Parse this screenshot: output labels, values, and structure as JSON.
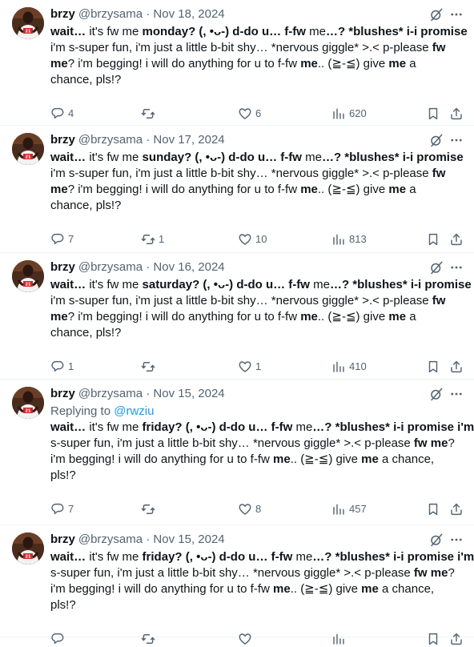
{
  "tweets": [
    {
      "name": "brzy",
      "meta": "@brzysama · Nov 18, 2024",
      "reply_prefix": "",
      "reply_handle": "",
      "lines": [
        [
          "|wait… |it's fw me| monday? (, •ᴗ-) d-do u… f-fw |me|…? *blushes* i-i promise"
        ],
        [
          "i'm s-super fun, i'm just a little b-bit shy… *nervous giggle* >.< p-please |fw"
        ],
        [
          "|me|? i'm begging! i will do anything for u to f-fw |me|.. (≧-≦) give |me| a"
        ],
        [
          "chance, pls!?"
        ]
      ],
      "replies": "4",
      "reposts": "",
      "likes": "6",
      "views": "620"
    },
    {
      "name": "brzy",
      "meta": "@brzysama · Nov 17, 2024",
      "reply_prefix": "",
      "reply_handle": "",
      "lines": [
        [
          "|wait… |it's fw me| sunday? (, •ᴗ-) d-do u… f-fw |me|…? *blushes* i-i promise"
        ],
        [
          "i'm s-super fun, i'm just a little b-bit shy… *nervous giggle* >.< p-please |fw"
        ],
        [
          "|me|? i'm begging! i will do anything for u to f-fw |me|.. (≧-≦) give |me| a"
        ],
        [
          "chance, pls!?"
        ]
      ],
      "replies": "7",
      "reposts": "1",
      "likes": "10",
      "views": "813"
    },
    {
      "name": "brzy",
      "meta": "@brzysama · Nov 16, 2024",
      "reply_prefix": "",
      "reply_handle": "",
      "lines": [
        [
          "|wait… |it's fw me| saturday? (, •ᴗ-) d-do u… f-fw |me|…? *blushes* i-i promise"
        ],
        [
          "i'm s-super fun, i'm just a little b-bit shy… *nervous giggle* >.< p-please |fw"
        ],
        [
          "|me|? i'm begging! i will do anything for u to f-fw |me|.. (≧-≦) give |me| a"
        ],
        [
          "chance, pls!?"
        ]
      ],
      "replies": "1",
      "reposts": "",
      "likes": "1",
      "views": "410"
    },
    {
      "name": "brzy",
      "meta": "@brzysama · Nov 15, 2024",
      "reply_prefix": "Replying to ",
      "reply_handle": "@rwziu",
      "lines": [
        [
          "|wait… |it's fw me| friday? (, •ᴗ-) d-do u… f-fw |me|…? *blushes* i-i promise i'm"
        ],
        [
          "s-super fun, i'm just a little b-bit shy… *nervous giggle* >.< p-please |fw me|?"
        ],
        [
          "i'm begging! i will do anything for u to f-fw |me|.. (≧-≦) give |me| a chance,"
        ],
        [
          "pls!?"
        ]
      ],
      "replies": "7",
      "reposts": "",
      "likes": "8",
      "views": "457"
    },
    {
      "name": "brzy",
      "meta": "@brzysama · Nov 15, 2024",
      "reply_prefix": "",
      "reply_handle": "",
      "lines": [
        [
          "|wait… |it's fw me| friday? (, •ᴗ-) d-do u… f-fw |me|…? *blushes* i-i promise i'm"
        ],
        [
          "s-super fun, i'm just a little b-bit shy… *nervous giggle* >.< p-please |fw me|?"
        ],
        [
          "i'm begging! i will do anything for u to f-fw |me|.. (≧-≦) give |me| a chance,"
        ],
        [
          "pls!?"
        ]
      ],
      "replies": "",
      "reposts": "",
      "likes": "",
      "views": ""
    }
  ],
  "icons": {
    "grok": "grok-slash-icon",
    "more": "more-dots-icon",
    "reply": "reply-bubble-icon",
    "repost": "repost-arrows-icon",
    "like": "heart-icon",
    "views": "views-bars-icon",
    "bookmark": "bookmark-icon",
    "share": "share-upload-icon"
  },
  "colors": {
    "text": "#0f1419",
    "secondary": "#536471",
    "link": "#1d9bf0",
    "divider": "#eff3f4"
  }
}
